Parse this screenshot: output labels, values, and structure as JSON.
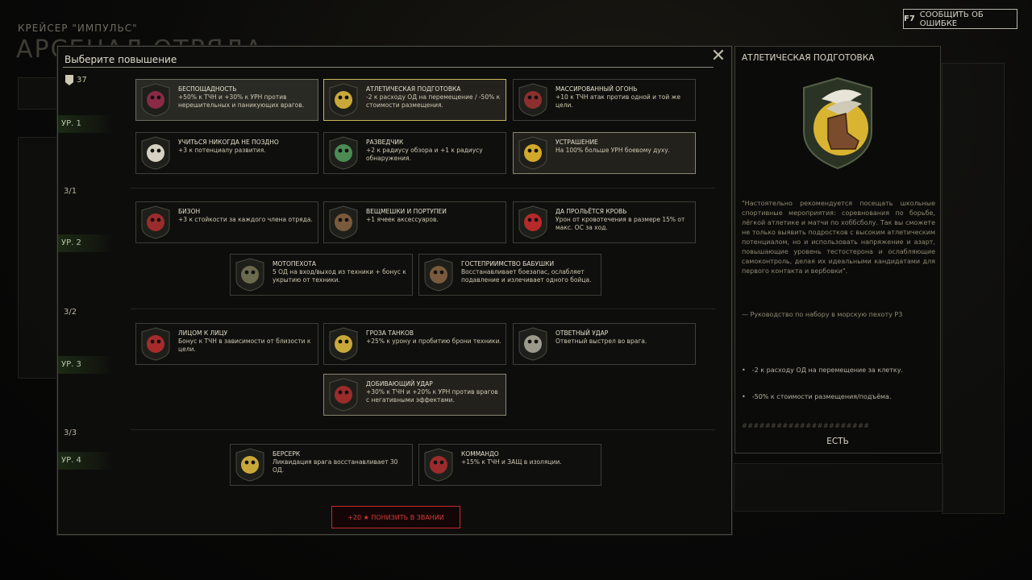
{
  "background": {
    "ship_label": "КРЕЙСЕР \"ИМПУЛЬС\"",
    "squad_label": "АРСЕНАЛ ОТРЯДА",
    "report": {
      "key": "F7",
      "label": "СООБЩИТЬ ОБ ОШИБКЕ"
    }
  },
  "modal": {
    "title": "Выберите повышение",
    "points": "37",
    "levels": [
      "УР. 1",
      "УР. 2",
      "УР. 3",
      "УР. 4"
    ],
    "tiers": [
      "3/1",
      "3/2",
      "3/3"
    ],
    "demote_label": "+20 ★ ПОНИЗИТЬ В ЗВАНИИ"
  },
  "perks": [
    {
      "name": "БЕСПОЩАДНОСТЬ",
      "desc": "+50% к ТЧН и +30% к УРН против нерешительных и паникующих врагов.",
      "icon": "heart-knife-icon",
      "color": "#8a2a44"
    },
    {
      "name": "АТЛЕТИЧЕСКАЯ ПОДГОТОВКА",
      "desc": "-2 к расходу ОД на перемещение / -50% к стоимости размещения.",
      "icon": "winged-boot-icon",
      "color": "#c9a83a"
    },
    {
      "name": "МАССИРОВАННЫЙ ОГОНЬ",
      "desc": "+10 к ТЧН атак против одной и той же цели.",
      "icon": "mask-icon",
      "color": "#8b2f2f"
    },
    {
      "name": "УЧИТЬСЯ НИКОГДА НЕ ПОЗДНО",
      "desc": "+3 к потенциалу развития.",
      "icon": "graduate-skull-icon",
      "color": "#d6d1c2"
    },
    {
      "name": "РАЗВЕДЧИК",
      "desc": "+2 к радиусу обзора и +1 к радиусу обнаружения.",
      "icon": "binocular-icon",
      "color": "#4d8b55"
    },
    {
      "name": "УСТРАШЕНИЕ",
      "desc": "На 100% больше УРН боевому духу.",
      "icon": "sun-skull-icon",
      "color": "#d2a82a"
    },
    {
      "name": "БИЗОН",
      "desc": "+3 к стойкости за каждого члена отряда.",
      "icon": "bicep-icon",
      "color": "#9b2c2c"
    },
    {
      "name": "ВЕЩМЕШКИ И ПОРТУПЕИ",
      "desc": "+1 ячеек аксессуаров.",
      "icon": "pouch-icon",
      "color": "#7a5a3c"
    },
    {
      "name": "ДА ПРОЛЬЁТСЯ КРОВЬ",
      "desc": "Урон от кровотечения в размере 15% от макс. ОС за ход.",
      "icon": "fangs-icon",
      "color": "#b72a2a"
    },
    {
      "name": "МОТОПЕХОТА",
      "desc": "5 ОД на вход/выход из техники + бонус к укрытию от техники.",
      "icon": "soldier-icon",
      "color": "#6b6a4e"
    },
    {
      "name": "ГОСТЕПРИИМСТВО БАБУШКИ",
      "desc": "Восстанавливает боезапас, ослабляет подавление и излечивает одного бойца.",
      "icon": "pouch-icon",
      "color": "#7a5a3c"
    },
    {
      "name": "ЛИЦОМ К ЛИЦУ",
      "desc": "Бонус к ТЧН в зависимости от близости к цели.",
      "icon": "faces-icon",
      "color": "#a82b2b"
    },
    {
      "name": "ГРОЗА ТАНКОВ",
      "desc": "+25% к урону и пробитию брони техники.",
      "icon": "explosion-icon",
      "color": "#c9a83a"
    },
    {
      "name": "ОТВЕТНЫЙ УДАР",
      "desc": "Ответный выстрел во врага.",
      "icon": "crossed-knives-icon",
      "color": "#9c9a8c"
    },
    {
      "name": "ДОБИВАЮЩИЙ УДАР",
      "desc": "+30% к ТЧН и +20% к УРН против врагов с негативными эффектами.",
      "icon": "fist-icon",
      "color": "#9b2c2c"
    },
    {
      "name": "БЕРСЕРК",
      "desc": "Ликвидация врага восстанавливает 30 ОД.",
      "icon": "berserk-icon",
      "color": "#c9a83a"
    },
    {
      "name": "КОММАНДО",
      "desc": "+15% к ТЧН и ЗАЩ в изоляции.",
      "icon": "beret-skull-icon",
      "color": "#9b2c2c"
    }
  ],
  "detail": {
    "title": "АТЛЕТИЧЕСКАЯ ПОДГОТОВКА",
    "badge_icon": "winged-boot-icon",
    "quote": "\"Настоятельно рекомендуется посещать школьные спортивные мероприятия: соревнования по борьбе, лёгкой атлетике и матчи по хоббсболу. Так вы сможете не только выявить подростков с высоким атлетическим потенциалом, но и использовать напряжение и азарт, повышающие уровень тестостерона и ослабляющие самоконтроль, делая их идеальными кандидатами для первого контакта и вербовки\".",
    "source": "— Руководство по набору в морскую пехоту Р3",
    "bullets": [
      "-2 к расходу ОД на перемещение за клетку.",
      "-50% к стоимости размещения/подъёма."
    ],
    "hashes": "######################",
    "status": "ЕСТЬ"
  }
}
